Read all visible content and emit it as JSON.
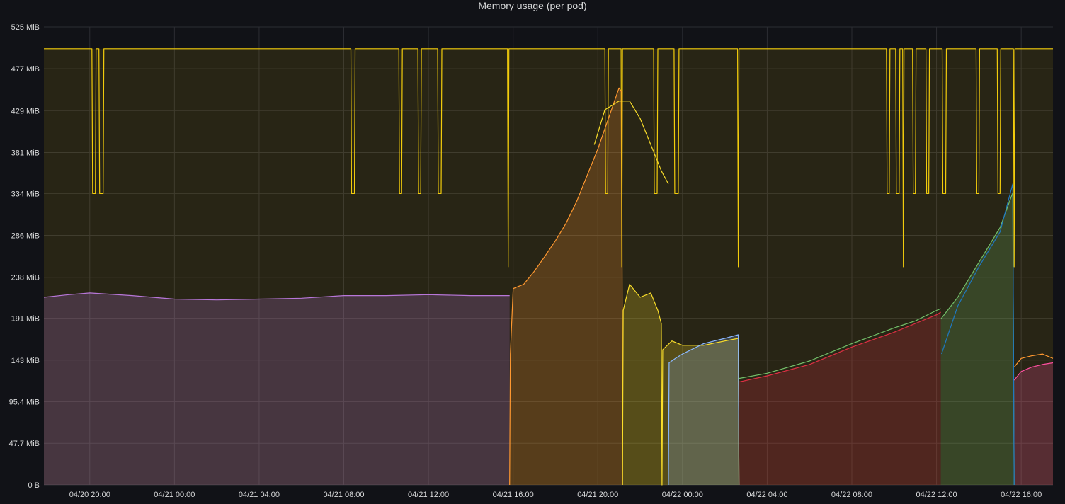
{
  "panel": {
    "title": "Memory usage (per pod)"
  },
  "colors": {
    "background": "#111217",
    "grid": "#2c2d33",
    "axis_text": "#d8d9da",
    "limit_line": "#f2cc0c",
    "purple": "#b877d9",
    "orange": "#ff9830",
    "yellow": "#fade2a",
    "light_blue": "#8ab8ff",
    "green": "#73bf69",
    "red": "#e02f44",
    "blue": "#1f78c1",
    "pink": "#ff4fa1"
  },
  "chart_data": {
    "type": "area",
    "title": "Memory usage (per pod)",
    "xlabel": "",
    "ylabel": "",
    "y_unit": "MiB",
    "ylim": [
      0,
      525
    ],
    "xlim": [
      "04/20 17:50",
      "04/22 17:30"
    ],
    "y_ticks": [
      {
        "v": 0,
        "label": "0 B"
      },
      {
        "v": 47.7,
        "label": "47.7 MiB"
      },
      {
        "v": 95.4,
        "label": "95.4 MiB"
      },
      {
        "v": 143,
        "label": "143 MiB"
      },
      {
        "v": 191,
        "label": "191 MiB"
      },
      {
        "v": 238,
        "label": "238 MiB"
      },
      {
        "v": 286,
        "label": "286 MiB"
      },
      {
        "v": 334,
        "label": "334 MiB"
      },
      {
        "v": 381,
        "label": "381 MiB"
      },
      {
        "v": 429,
        "label": "429 MiB"
      },
      {
        "v": 477,
        "label": "477 MiB"
      },
      {
        "v": 525,
        "label": "525 MiB"
      }
    ],
    "x_ticks": [
      {
        "t": "04/20 20:00",
        "label": "04/20 20:00"
      },
      {
        "t": "04/21 00:00",
        "label": "04/21 00:00"
      },
      {
        "t": "04/21 04:00",
        "label": "04/21 04:00"
      },
      {
        "t": "04/21 08:00",
        "label": "04/21 08:00"
      },
      {
        "t": "04/21 12:00",
        "label": "04/21 12:00"
      },
      {
        "t": "04/21 16:00",
        "label": "04/21 16:00"
      },
      {
        "t": "04/21 20:00",
        "label": "04/21 20:00"
      },
      {
        "t": "04/22 00:00",
        "label": "04/22 00:00"
      },
      {
        "t": "04/22 04:00",
        "label": "04/22 04:00"
      },
      {
        "t": "04/22 08:00",
        "label": "04/22 08:00"
      },
      {
        "t": "04/22 12:00",
        "label": "04/22 12:00"
      },
      {
        "t": "04/22 16:00",
        "label": "04/22 16:00"
      }
    ],
    "grid": true,
    "legend": "none",
    "series": [
      {
        "color_key": "limit_line",
        "fill": false,
        "style": "step",
        "points": [
          [
            "04/20 17:50",
            500
          ],
          [
            "04/20 20:06",
            500
          ],
          [
            "04/20 20:08",
            334
          ],
          [
            "04/20 20:16",
            334
          ],
          [
            "04/20 20:18",
            500
          ],
          [
            "04/20 20:26",
            500
          ],
          [
            "04/20 20:28",
            334
          ],
          [
            "04/20 20:38",
            334
          ],
          [
            "04/20 20:40",
            500
          ],
          [
            "04/21 08:20",
            500
          ],
          [
            "04/21 08:22",
            334
          ],
          [
            "04/21 08:30",
            334
          ],
          [
            "04/21 08:32",
            500
          ],
          [
            "04/21 10:36",
            500
          ],
          [
            "04/21 10:38",
            334
          ],
          [
            "04/21 10:44",
            334
          ],
          [
            "04/21 10:46",
            500
          ],
          [
            "04/21 11:30",
            500
          ],
          [
            "04/21 11:32",
            334
          ],
          [
            "04/21 11:38",
            334
          ],
          [
            "04/21 11:40",
            500
          ],
          [
            "04/21 12:26",
            500
          ],
          [
            "04/21 12:28",
            334
          ],
          [
            "04/21 12:36",
            334
          ],
          [
            "04/21 12:38",
            500
          ],
          [
            "04/21 15:44",
            500
          ],
          [
            "04/21 15:46",
            250
          ],
          [
            "04/21 15:48",
            500
          ],
          [
            "04/21 20:20",
            500
          ],
          [
            "04/21 20:22",
            334
          ],
          [
            "04/21 20:28",
            334
          ],
          [
            "04/21 20:30",
            500
          ],
          [
            "04/21 21:06",
            500
          ],
          [
            "04/21 21:08",
            250
          ],
          [
            "04/21 21:10",
            500
          ],
          [
            "04/21 22:38",
            500
          ],
          [
            "04/21 22:40",
            334
          ],
          [
            "04/21 22:48",
            334
          ],
          [
            "04/21 22:50",
            500
          ],
          [
            "04/21 23:36",
            500
          ],
          [
            "04/21 23:38",
            334
          ],
          [
            "04/21 23:48",
            334
          ],
          [
            "04/21 23:50",
            500
          ],
          [
            "04/22 02:36",
            500
          ],
          [
            "04/22 02:38",
            250
          ],
          [
            "04/22 02:40",
            500
          ],
          [
            "04/22 09:38",
            500
          ],
          [
            "04/22 09:40",
            334
          ],
          [
            "04/22 09:46",
            334
          ],
          [
            "04/22 09:48",
            500
          ],
          [
            "04/22 10:04",
            500
          ],
          [
            "04/22 10:06",
            334
          ],
          [
            "04/22 10:14",
            334
          ],
          [
            "04/22 10:16",
            500
          ],
          [
            "04/22 10:24",
            500
          ],
          [
            "04/22 10:26",
            250
          ],
          [
            "04/22 10:28",
            500
          ],
          [
            "04/22 10:52",
            500
          ],
          [
            "04/22 10:54",
            334
          ],
          [
            "04/22 11:00",
            334
          ],
          [
            "04/22 11:02",
            500
          ],
          [
            "04/22 11:30",
            500
          ],
          [
            "04/22 11:32",
            334
          ],
          [
            "04/22 11:38",
            334
          ],
          [
            "04/22 11:40",
            500
          ],
          [
            "04/22 12:16",
            500
          ],
          [
            "04/22 12:18",
            334
          ],
          [
            "04/22 12:26",
            334
          ],
          [
            "04/22 12:28",
            500
          ],
          [
            "04/22 13:52",
            500
          ],
          [
            "04/22 13:54",
            334
          ],
          [
            "04/22 14:00",
            334
          ],
          [
            "04/22 14:02",
            500
          ],
          [
            "04/22 14:52",
            500
          ],
          [
            "04/22 14:54",
            334
          ],
          [
            "04/22 15:00",
            334
          ],
          [
            "04/22 15:02",
            500
          ],
          [
            "04/22 15:38",
            500
          ],
          [
            "04/22 15:40",
            250
          ],
          [
            "04/22 15:42",
            500
          ],
          [
            "04/22 17:30",
            500
          ]
        ]
      },
      {
        "color_key": "purple",
        "fill": true,
        "style": "line",
        "points": [
          [
            "04/20 17:50",
            215
          ],
          [
            "04/20 19:00",
            218
          ],
          [
            "04/20 20:00",
            220
          ],
          [
            "04/20 22:00",
            217
          ],
          [
            "04/21 00:00",
            213
          ],
          [
            "04/21 02:00",
            212
          ],
          [
            "04/21 04:00",
            213
          ],
          [
            "04/21 06:00",
            214
          ],
          [
            "04/21 08:00",
            217
          ],
          [
            "04/21 10:00",
            217
          ],
          [
            "04/21 12:00",
            218
          ],
          [
            "04/21 14:00",
            217
          ],
          [
            "04/21 15:50",
            217
          ]
        ]
      },
      {
        "color_key": "orange",
        "fill": true,
        "style": "line",
        "points": [
          [
            "04/21 15:50",
            0
          ],
          [
            "04/21 15:52",
            150
          ],
          [
            "04/21 16:00",
            225
          ],
          [
            "04/21 16:30",
            230
          ],
          [
            "04/21 17:00",
            245
          ],
          [
            "04/21 17:30",
            262
          ],
          [
            "04/21 18:00",
            280
          ],
          [
            "04/21 18:30",
            300
          ],
          [
            "04/21 19:00",
            325
          ],
          [
            "04/21 19:30",
            355
          ],
          [
            "04/21 20:00",
            385
          ],
          [
            "04/21 20:30",
            420
          ],
          [
            "04/21 21:00",
            455
          ],
          [
            "04/21 21:08",
            450
          ],
          [
            "04/21 21:10",
            0
          ]
        ]
      },
      {
        "color_key": "yellow",
        "fill": true,
        "style": "line",
        "points": [
          [
            "04/21 21:10",
            0
          ],
          [
            "04/21 21:12",
            200
          ],
          [
            "04/21 21:30",
            230
          ],
          [
            "04/21 22:00",
            215
          ],
          [
            "04/21 22:30",
            220
          ],
          [
            "04/21 22:50",
            200
          ],
          [
            "04/21 23:00",
            185
          ],
          [
            "04/21 23:02",
            0
          ],
          [
            "04/21 23:04",
            155
          ],
          [
            "04/21 23:30",
            165
          ],
          [
            "04/22 00:00",
            160
          ],
          [
            "04/22 01:00",
            160
          ],
          [
            "04/22 02:00",
            165
          ],
          [
            "04/22 02:38",
            168
          ],
          [
            "04/22 02:40",
            0
          ]
        ]
      },
      {
        "color_key": "yellow",
        "fill": false,
        "style": "line",
        "points": [
          [
            "04/21 19:50",
            390
          ],
          [
            "04/21 20:20",
            430
          ],
          [
            "04/21 21:00",
            440
          ],
          [
            "04/21 21:30",
            440
          ],
          [
            "04/21 22:00",
            420
          ],
          [
            "04/21 22:30",
            390
          ],
          [
            "04/21 23:00",
            360
          ],
          [
            "04/21 23:20",
            345
          ]
        ]
      },
      {
        "color_key": "light_blue",
        "fill": true,
        "style": "line",
        "points": [
          [
            "04/21 23:20",
            0
          ],
          [
            "04/21 23:22",
            140
          ],
          [
            "04/21 23:40",
            145
          ],
          [
            "04/22 00:00",
            150
          ],
          [
            "04/22 01:00",
            162
          ],
          [
            "04/22 02:00",
            168
          ],
          [
            "04/22 02:38",
            172
          ],
          [
            "04/22 02:40",
            0
          ]
        ]
      },
      {
        "color_key": "red",
        "fill": true,
        "style": "line",
        "points": [
          [
            "04/22 02:40",
            118
          ],
          [
            "04/22 04:00",
            125
          ],
          [
            "04/22 06:00",
            138
          ],
          [
            "04/22 08:00",
            158
          ],
          [
            "04/22 10:00",
            175
          ],
          [
            "04/22 11:00",
            185
          ],
          [
            "04/22 12:00",
            195
          ],
          [
            "04/22 12:12",
            198
          ]
        ]
      },
      {
        "color_key": "green",
        "fill": false,
        "style": "line",
        "points": [
          [
            "04/22 02:40",
            122
          ],
          [
            "04/22 04:00",
            128
          ],
          [
            "04/22 06:00",
            142
          ],
          [
            "04/22 08:00",
            162
          ],
          [
            "04/22 10:00",
            180
          ],
          [
            "04/22 11:00",
            188
          ],
          [
            "04/22 12:00",
            200
          ],
          [
            "04/22 12:12",
            202
          ]
        ]
      },
      {
        "color_key": "green",
        "fill": true,
        "style": "line",
        "points": [
          [
            "04/22 12:12",
            190
          ],
          [
            "04/22 13:00",
            215
          ],
          [
            "04/22 14:00",
            255
          ],
          [
            "04/22 15:00",
            295
          ],
          [
            "04/22 15:36",
            335
          ],
          [
            "04/22 15:40",
            0
          ]
        ]
      },
      {
        "color_key": "blue",
        "fill": false,
        "style": "line",
        "points": [
          [
            "04/22 12:14",
            150
          ],
          [
            "04/22 13:00",
            205
          ],
          [
            "04/22 14:00",
            250
          ],
          [
            "04/22 15:00",
            290
          ],
          [
            "04/22 15:36",
            345
          ],
          [
            "04/22 15:40",
            0
          ]
        ]
      },
      {
        "color_key": "pink",
        "fill": true,
        "style": "line",
        "points": [
          [
            "04/22 15:40",
            120
          ],
          [
            "04/22 16:00",
            130
          ],
          [
            "04/22 16:30",
            135
          ],
          [
            "04/22 17:00",
            138
          ],
          [
            "04/22 17:30",
            140
          ]
        ]
      },
      {
        "color_key": "orange",
        "fill": false,
        "style": "line",
        "points": [
          [
            "04/22 15:40",
            135
          ],
          [
            "04/22 16:00",
            145
          ],
          [
            "04/22 16:30",
            148
          ],
          [
            "04/22 17:00",
            150
          ],
          [
            "04/22 17:30",
            145
          ]
        ]
      }
    ]
  }
}
